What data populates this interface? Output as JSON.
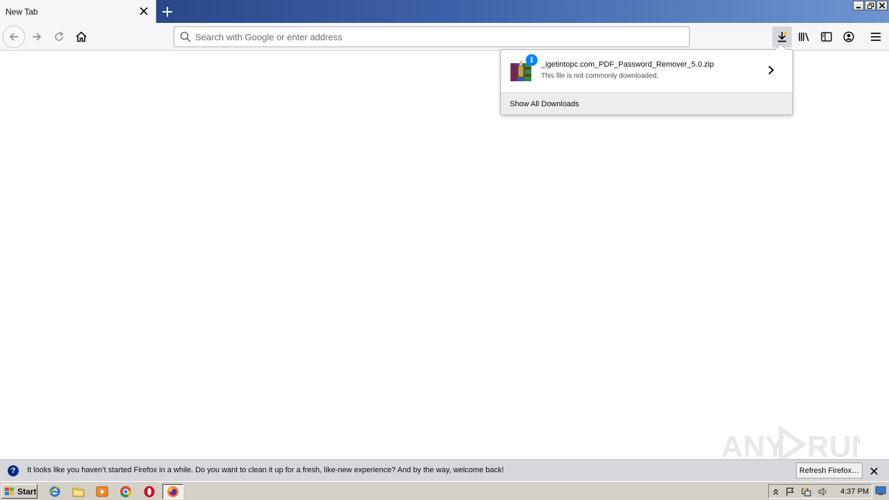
{
  "browser": {
    "tab": {
      "title": "New Tab"
    },
    "urlbar": {
      "placeholder": "Search with Google or enter address",
      "value": ""
    }
  },
  "downloads_panel": {
    "item": {
      "filename": "_igetintopc.com_PDF_Password_Remover_5.0.zip",
      "status": "This file is not commonly downloaded."
    },
    "footer_label": "Show All Downloads"
  },
  "notification": {
    "message": "It looks like you haven’t started Firefox in a while. Do you want to clean it up for a fresh, like-new experience? And by the way, welcome back!",
    "button_label": "Refresh Firefox…"
  },
  "taskbar": {
    "start_label": "Start",
    "clock": "4:37 PM"
  },
  "watermark": {
    "text": "ANY RUN"
  },
  "colors": {
    "accent": "#0a84ff",
    "titlebar": "#2b4a8f",
    "taskbar": "#d4d0c8"
  }
}
